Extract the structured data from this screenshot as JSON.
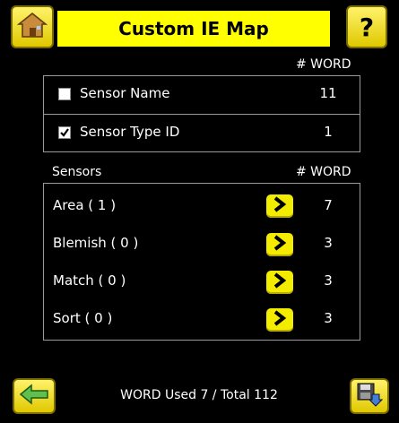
{
  "header": {
    "title": "Custom IE Map",
    "home_icon": "home-icon",
    "help_icon": "help-icon",
    "help_glyph": "?"
  },
  "general": {
    "column_header": "# WORD",
    "rows": [
      {
        "label": "Sensor Name",
        "checked": false,
        "value": "11"
      },
      {
        "label": "Sensor Type ID",
        "checked": true,
        "value": "1"
      }
    ]
  },
  "sensors": {
    "header_label": "Sensors",
    "column_header": "# WORD",
    "rows": [
      {
        "label": "Area ( 1 )",
        "value": "7"
      },
      {
        "label": "Blemish ( 0 )",
        "value": "3"
      },
      {
        "label": "Match ( 0 )",
        "value": "3"
      },
      {
        "label": "Sort ( 0 )",
        "value": "3"
      }
    ]
  },
  "footer": {
    "status": "WORD Used 7 / Total 112",
    "back_icon": "back-arrow-icon",
    "save_icon": "save-icon"
  },
  "colors": {
    "accent": "#ffff00",
    "background": "#000000",
    "border": "#9a9a9a"
  }
}
